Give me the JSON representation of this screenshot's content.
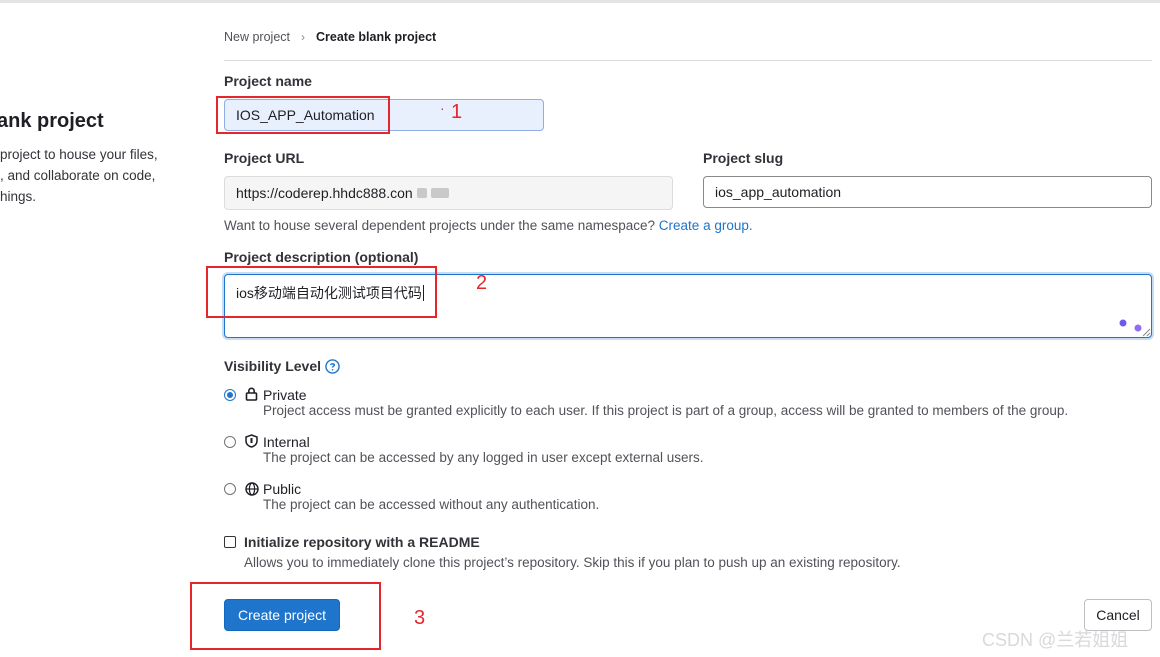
{
  "side_panel": {
    "title": "ank project",
    "lines": [
      "project to house your files,",
      ", and collaborate on code,",
      "hings."
    ]
  },
  "breadcrumb": {
    "items": [
      "New project",
      "Create blank project"
    ],
    "separator": "›"
  },
  "form": {
    "project_name": {
      "label": "Project name",
      "value": "IOS_APP_Automation"
    },
    "project_url": {
      "label": "Project URL",
      "value": "https://coderep.hhdc888.con"
    },
    "project_slug": {
      "label": "Project slug",
      "value": "ios_app_automation"
    },
    "namespace_help": {
      "text": "Want to house several dependent projects under the same namespace?",
      "link": "Create a group."
    },
    "description": {
      "label": "Project description (optional)",
      "value": "ios移动端自动化测试项目代码"
    },
    "visibility": {
      "label": "Visibility Level",
      "options": [
        {
          "title": "Private",
          "icon": "lock-icon",
          "checked": true,
          "desc": "Project access must be granted explicitly to each user. If this project is part of a group, access will be granted to members of the group."
        },
        {
          "title": "Internal",
          "icon": "shield-icon",
          "checked": false,
          "desc": "The project can be accessed by any logged in user except external users."
        },
        {
          "title": "Public",
          "icon": "globe-icon",
          "checked": false,
          "desc": "The project can be accessed without any authentication."
        }
      ]
    },
    "readme": {
      "label": "Initialize repository with a README",
      "desc": "Allows you to immediately clone this project’s repository. Skip this if you plan to push up an existing repository.",
      "checked": false
    }
  },
  "buttons": {
    "create": "Create project",
    "cancel": "Cancel"
  },
  "annotations": {
    "one": "1",
    "two": "2",
    "three": "3",
    "dot": "·"
  },
  "watermark": "CSDN @兰若姐姐",
  "colors": {
    "primary": "#1f75cb",
    "annotation_red": "#e5262b",
    "text": "#333238"
  }
}
